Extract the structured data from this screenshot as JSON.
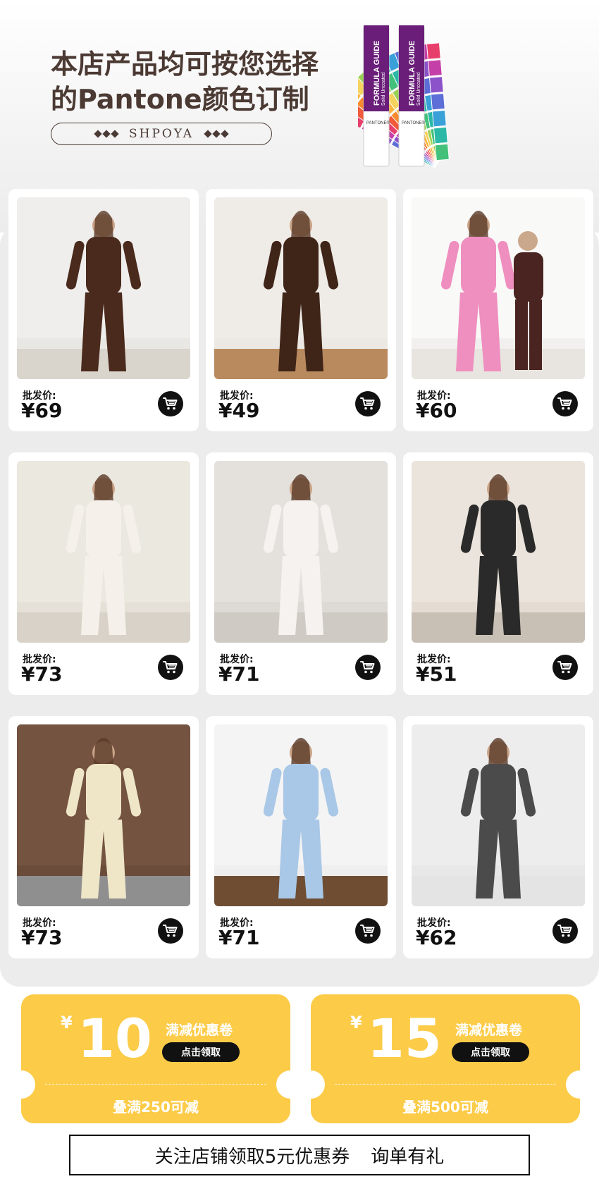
{
  "header": {
    "headline_line1": "本店产品均可按您选择",
    "headline_line2": "的Pantone颜色订制",
    "brand": "SHPOYA",
    "swatch_book": {
      "title": "FORMULA GUIDE",
      "subtitle": "Solid Uncoated",
      "label": "PANTONE®"
    }
  },
  "products": [
    {
      "price_label": "批发价:",
      "price": "¥69",
      "photo": "brown-pajama-set"
    },
    {
      "price_label": "批发价:",
      "price": "¥49",
      "photo": "brown-knit-set"
    },
    {
      "price_label": "批发价:",
      "price": "¥60",
      "photo": "pink-and-brown-satin-sets"
    },
    {
      "price_label": "批发价:",
      "price": "¥73",
      "photo": "white-floral-robe-set"
    },
    {
      "price_label": "批发价:",
      "price": "¥71",
      "photo": "white-pink-dot-set"
    },
    {
      "price_label": "批发价:",
      "price": "¥51",
      "photo": "zebra-print-shorts-set"
    },
    {
      "price_label": "批发价:",
      "price": "¥73",
      "photo": "cream-three-piece-set"
    },
    {
      "price_label": "批发价:",
      "price": "¥71",
      "photo": "blue-ruffle-set"
    },
    {
      "price_label": "批发价:",
      "price": "¥62",
      "photo": "charcoal-satin-set"
    }
  ],
  "coupons": [
    {
      "currency": "¥",
      "amount": "10",
      "type": "满减优惠卷",
      "claim": "点击领取",
      "condition": "叠满250可减"
    },
    {
      "currency": "¥",
      "amount": "15",
      "type": "满减优惠卷",
      "claim": "点击领取",
      "condition": "叠满500可减"
    }
  ],
  "follow": {
    "text1": "关注店铺领取5元优惠券",
    "text2": "询单有礼"
  },
  "colors": {
    "headline": "#4b3a33",
    "panel_bg": "#ececec",
    "coupon": "#fccb48",
    "cart": "#111111"
  },
  "icons": [
    "cart-icon",
    "diamond-icon"
  ]
}
